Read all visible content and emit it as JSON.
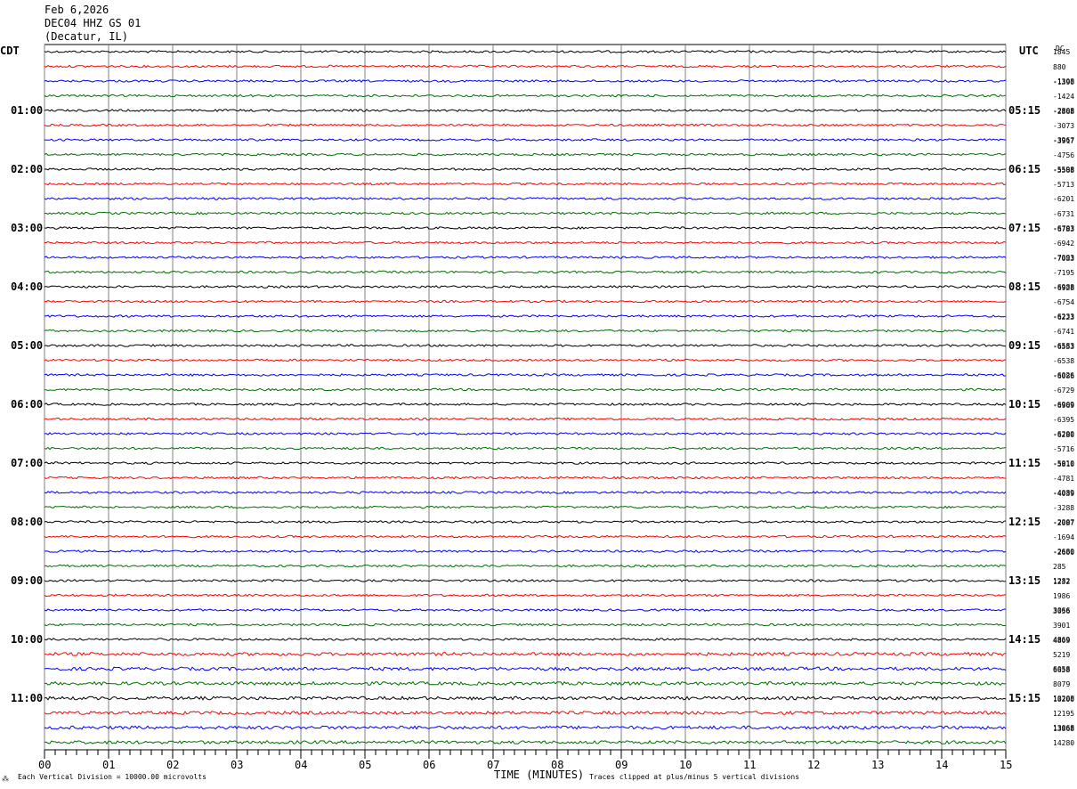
{
  "header": {
    "date": "Feb 6,2026",
    "station": "DEC04 HHZ GS 01",
    "location": "(Decatur, IL)"
  },
  "left_tz": "CDT",
  "right_tz": "UTC",
  "dc_header": "DC",
  "footer": {
    "scale_note": "Each Vertical Division = 10000.00 microvolts",
    "clip_note": "Traces clipped at plus/minus 5 vertical divisions",
    "corner_mark": "⁂"
  },
  "colors": {
    "trace_cycle": [
      "#000000",
      "#ff0000",
      "#0000ff",
      "#007000"
    ],
    "grid": "#808080"
  },
  "chart_data": {
    "type": "line",
    "xlabel": "TIME (MINUTES)",
    "xlim": [
      0,
      15
    ],
    "x_ticks": [
      "00",
      "01",
      "02",
      "03",
      "04",
      "05",
      "06",
      "07",
      "08",
      "09",
      "10",
      "11",
      "12",
      "13",
      "14",
      "15"
    ],
    "left_hour_labels": [
      "01:00",
      "02:00",
      "03:00",
      "04:00",
      "05:00",
      "06:00",
      "07:00",
      "08:00",
      "09:00",
      "10:00",
      "11:00"
    ],
    "right_hour_labels": [
      "05:15",
      "06:15",
      "07:15",
      "08:15",
      "09:15",
      "10:15",
      "11:15",
      "12:15",
      "13:15",
      "14:15",
      "15:15"
    ],
    "traces_per_hour": 4,
    "trace_count": 48,
    "dc_offsets": [
      [
        "1845"
      ],
      [
        "880"
      ],
      [
        "-1308",
        "-1390"
      ],
      [
        "-1424"
      ],
      [
        "-2808",
        "-2868"
      ],
      [
        "-3073"
      ],
      [
        "-3967",
        "-3917"
      ],
      [
        "-4756"
      ],
      [
        "-5598",
        "-5568"
      ],
      [
        "-5713"
      ],
      [
        "-6201"
      ],
      [
        "-6731"
      ],
      [
        "-6703",
        "-6783"
      ],
      [
        "-6942"
      ],
      [
        "-7093",
        "-7083"
      ],
      [
        "-7195"
      ],
      [
        "-6988",
        "-6928"
      ],
      [
        "-6754"
      ],
      [
        "-6233",
        "-6223"
      ],
      [
        "-6741"
      ],
      [
        "-6583",
        "-6553"
      ],
      [
        "-6538"
      ],
      [
        "-6026",
        "-6086"
      ],
      [
        "-6729"
      ],
      [
        "-6909",
        "-6969"
      ],
      [
        "-6395"
      ],
      [
        "-6200",
        "-6280"
      ],
      [
        "-5716"
      ],
      [
        "-5010",
        "-5810"
      ],
      [
        "-4781"
      ],
      [
        "-4089",
        "-4039"
      ],
      [
        "-3288"
      ],
      [
        "-2007",
        "-2087"
      ],
      [
        "-1694"
      ],
      [
        "-2680",
        "-2600"
      ],
      [
        "285"
      ],
      [
        "1282",
        "1232"
      ],
      [
        "1986"
      ],
      [
        "3066",
        "3056"
      ],
      [
        "3901"
      ],
      [
        "4869",
        "4809"
      ],
      [
        "5219"
      ],
      [
        "6058",
        "6658"
      ],
      [
        "8079"
      ],
      [
        "10208",
        "10200"
      ],
      [
        "12195"
      ],
      [
        "13068",
        "13868"
      ],
      [
        "14280"
      ]
    ]
  }
}
